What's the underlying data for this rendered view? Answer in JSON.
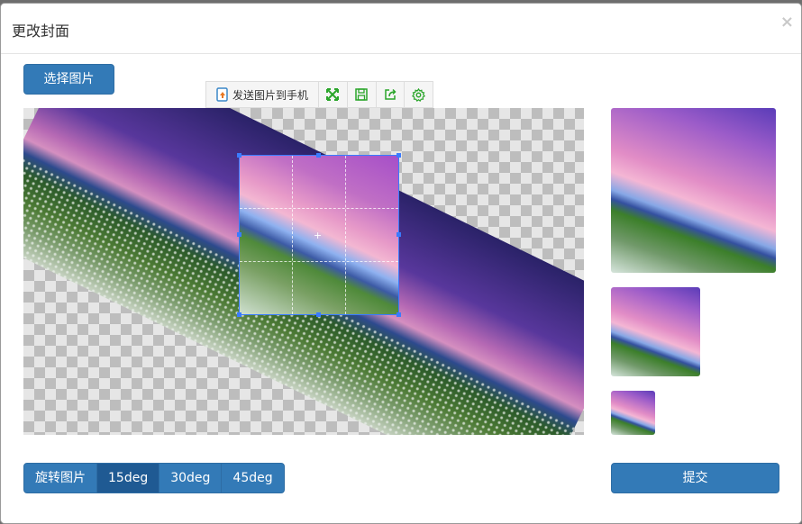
{
  "dialog": {
    "title": "更改封面",
    "close_label": "×"
  },
  "select_button": {
    "label": "选择图片"
  },
  "toolbar": {
    "send_label": "发送图片到手机",
    "icons": [
      "send-to-phone-icon",
      "fullscreen-icon",
      "save-icon",
      "share-icon",
      "settings-icon"
    ],
    "icon_color": "#2aa52a"
  },
  "rotate_group": {
    "label": "旋转图片",
    "options": [
      "15deg",
      "30deg",
      "45deg"
    ],
    "active": "15deg"
  },
  "submit_button": {
    "label": "提交"
  },
  "colors": {
    "primary": "#337ab7",
    "primary_border": "#2e6da4",
    "active": "#1f5a93",
    "crop_border": "#3a7bff"
  }
}
